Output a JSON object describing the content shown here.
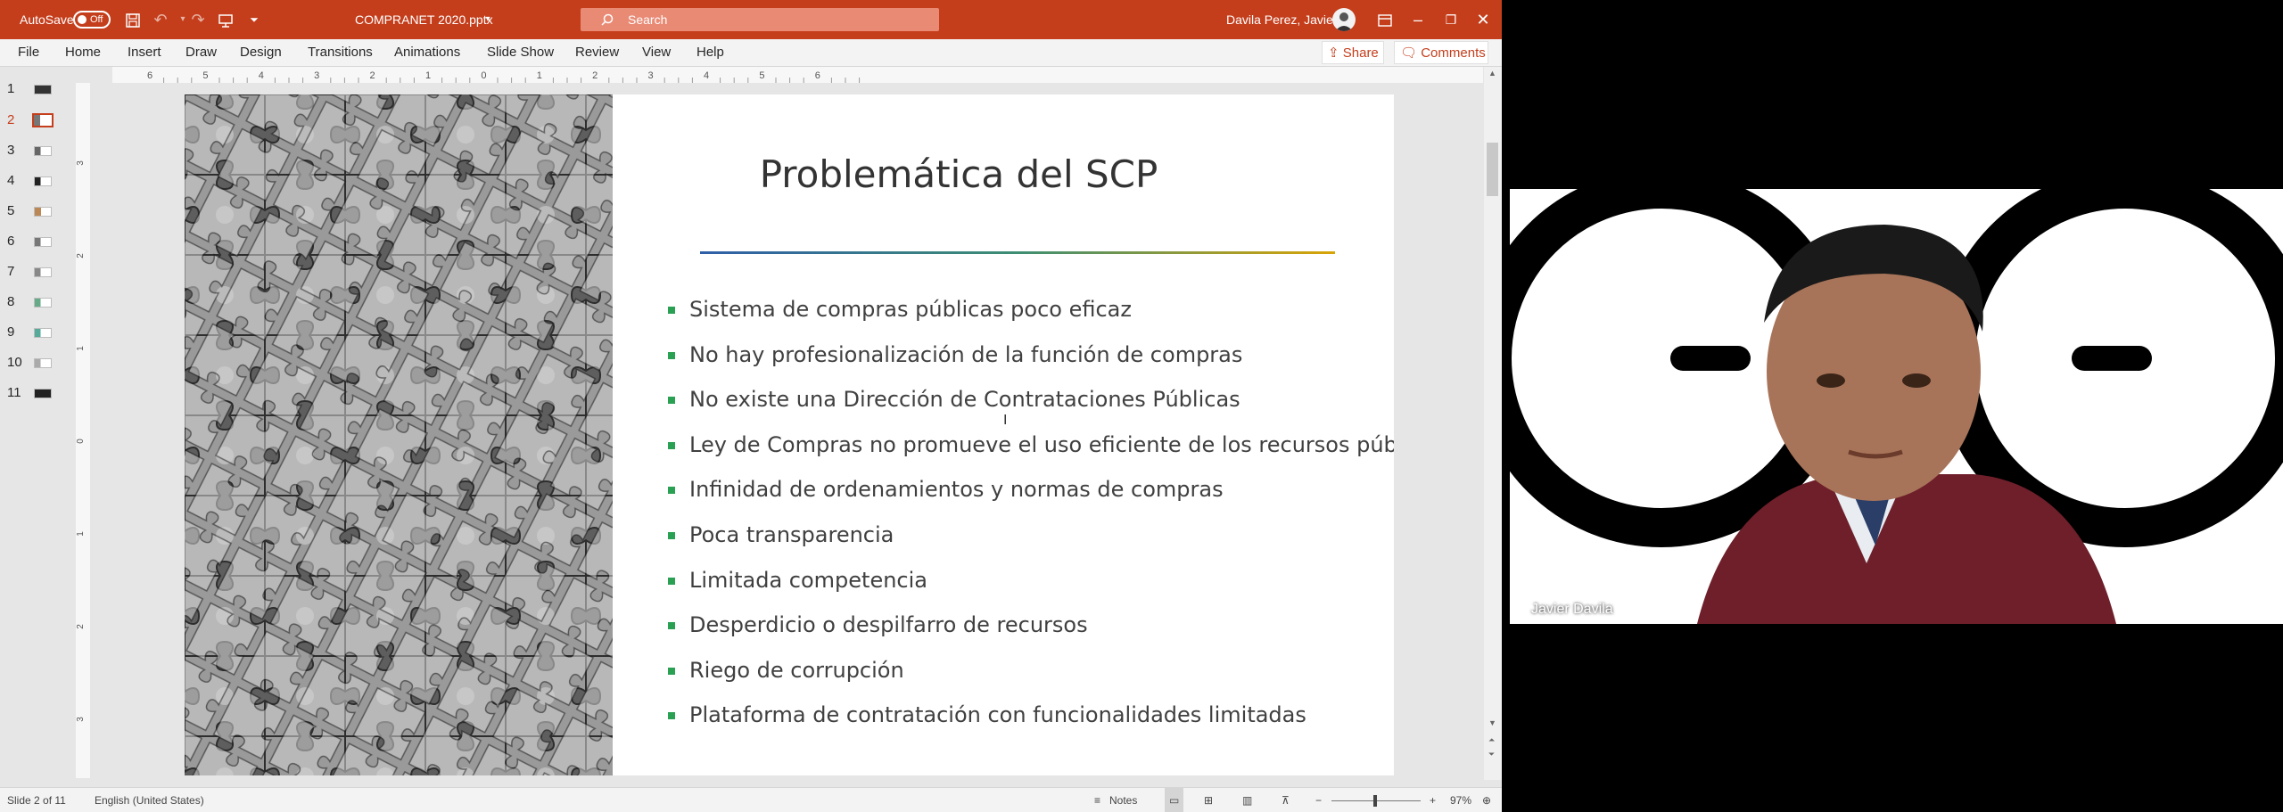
{
  "titlebar": {
    "autosave_label": "AutoSave",
    "autosave_state": "Off",
    "filename": "COMPRANET 2020.pptx",
    "search_placeholder": "Search",
    "user_name": "Davila Perez, Javier"
  },
  "ribbon": {
    "tabs": [
      "File",
      "Home",
      "Insert",
      "Draw",
      "Design",
      "Transitions",
      "Animations",
      "Slide Show",
      "Review",
      "View",
      "Help"
    ],
    "share_label": "Share",
    "comments_label": "Comments"
  },
  "thumbnails": [
    "1",
    "2",
    "3",
    "4",
    "5",
    "6",
    "7",
    "8",
    "9",
    "10",
    "11"
  ],
  "active_slide": 2,
  "ruler": {
    "horizontal_ticks": [
      "6",
      "5",
      "4",
      "3",
      "2",
      "1",
      "0",
      "1",
      "2",
      "3",
      "4",
      "5",
      "6"
    ],
    "vertical_ticks": [
      "3",
      "2",
      "1",
      "0",
      "1",
      "2",
      "3"
    ]
  },
  "slide": {
    "title": "Problemática del SCP",
    "bullets": [
      "Sistema de compras públicas poco eficaz",
      "No hay profesionalización de la función de compras",
      "No existe una Dirección de Contrataciones Públicas",
      "Ley de Compras no promueve el uso eficiente de los recursos públicos",
      "Infinidad de ordenamientos y normas de compras",
      "Poca transparencia",
      "Limitada competencia",
      "Desperdicio o despilfarro de recursos",
      "Riego de corrupción",
      "Plataforma de contratación con funcionalidades limitadas"
    ]
  },
  "statusbar": {
    "slide_info": "Slide 2 of 11",
    "language": "English (United States)",
    "notes_label": "Notes",
    "zoom": "97%",
    "zoom_minus": "−",
    "zoom_plus": "+"
  },
  "video": {
    "participant_name": "Javier Davila"
  },
  "colors": {
    "titlebar": "#c43e1c",
    "bullet": "#2aa052",
    "accent_line_start": "#2f5ea8",
    "accent_line_end": "#d9a406"
  }
}
